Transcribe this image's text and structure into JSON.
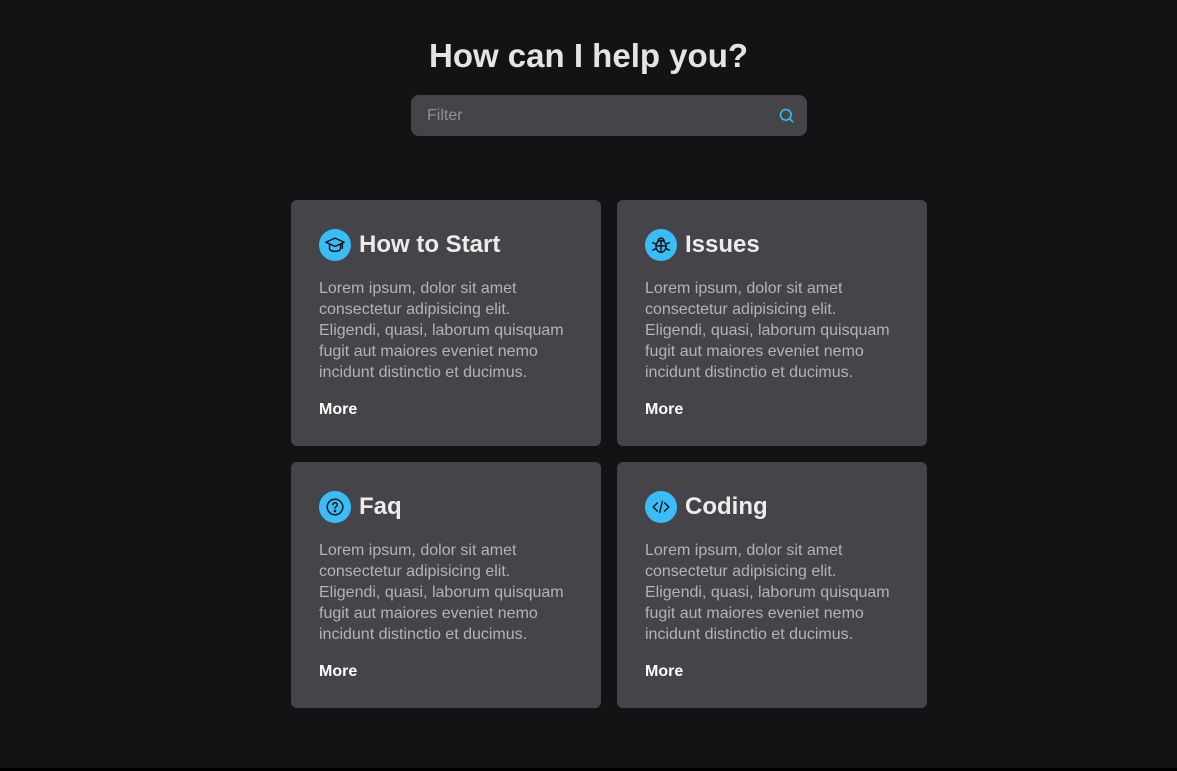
{
  "header": {
    "title": "How can I help you?"
  },
  "search": {
    "placeholder": "Filter",
    "value": "",
    "icon": "search-icon"
  },
  "colors": {
    "background": "#131316",
    "card": "#454549",
    "accent": "#38bdf8"
  },
  "cards": [
    {
      "title": "How to Start",
      "icon": "graduation-cap-icon",
      "text": "Lorem ipsum, dolor sit amet consectetur adipisicing elit. Eligendi, quasi, laborum quisquam fugit aut maiores eveniet nemo incidunt distinctio et ducimus.",
      "more": "More"
    },
    {
      "title": "Issues",
      "icon": "bug-icon",
      "text": "Lorem ipsum, dolor sit amet consectetur adipisicing elit. Eligendi, quasi, laborum quisquam fugit aut maiores eveniet nemo incidunt distinctio et ducimus.",
      "more": "More"
    },
    {
      "title": "Faq",
      "icon": "question-icon",
      "text": "Lorem ipsum, dolor sit amet consectetur adipisicing elit. Eligendi, quasi, laborum quisquam fugit aut maiores eveniet nemo incidunt distinctio et ducimus.",
      "more": "More"
    },
    {
      "title": "Coding",
      "icon": "code-icon",
      "text": "Lorem ipsum, dolor sit amet consectetur adipisicing elit. Eligendi, quasi, laborum quisquam fugit aut maiores eveniet nemo incidunt distinctio et ducimus.",
      "more": "More"
    }
  ]
}
